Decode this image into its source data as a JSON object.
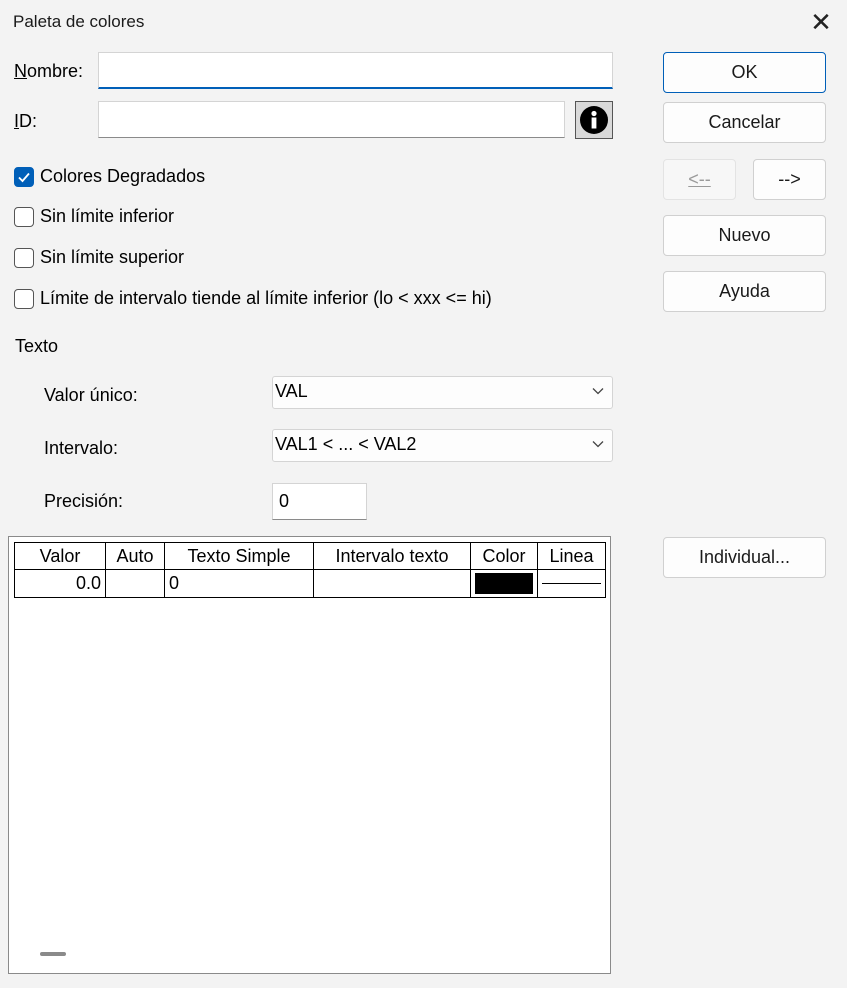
{
  "window": {
    "title": "Paleta de colores",
    "close_glyph": "✕"
  },
  "form": {
    "nombre_label": "Nombre:",
    "nombre_value": "",
    "id_label": "ID:",
    "id_value": ""
  },
  "info_icon": "info-circle-icon",
  "checkboxes": [
    {
      "label": "Colores Degradados",
      "checked": true
    },
    {
      "label": "Sin límite inferior",
      "checked": false
    },
    {
      "label": "Sin límite superior",
      "checked": false
    },
    {
      "label": "Límite de intervalo tiende al límite inferior (lo < xxx <= hi)",
      "checked": false
    }
  ],
  "texto": {
    "section_label": "Texto",
    "valor_unico_label": "Valor único:",
    "valor_unico_value": "VAL",
    "intervalo_label": "Intervalo:",
    "intervalo_value": "VAL1 < ... < VAL2",
    "precision_label": "Precisión:",
    "precision_value": "0"
  },
  "buttons": {
    "ok": "OK",
    "cancel": "Cancelar",
    "prev": "<--",
    "next": "-->",
    "new": "Nuevo",
    "help": "Ayuda",
    "individual": "Individual..."
  },
  "table": {
    "headers": [
      "Valor",
      "Auto",
      "Texto Simple",
      "Intervalo texto",
      "Color",
      "Linea"
    ],
    "rows": [
      {
        "valor": "0.0",
        "auto": "",
        "texto_simple": "0",
        "intervalo_texto": "",
        "color": "#000000",
        "linea": "solid"
      }
    ]
  },
  "colors": {
    "accent": "#005fb8",
    "background": "#f3f3f3"
  }
}
